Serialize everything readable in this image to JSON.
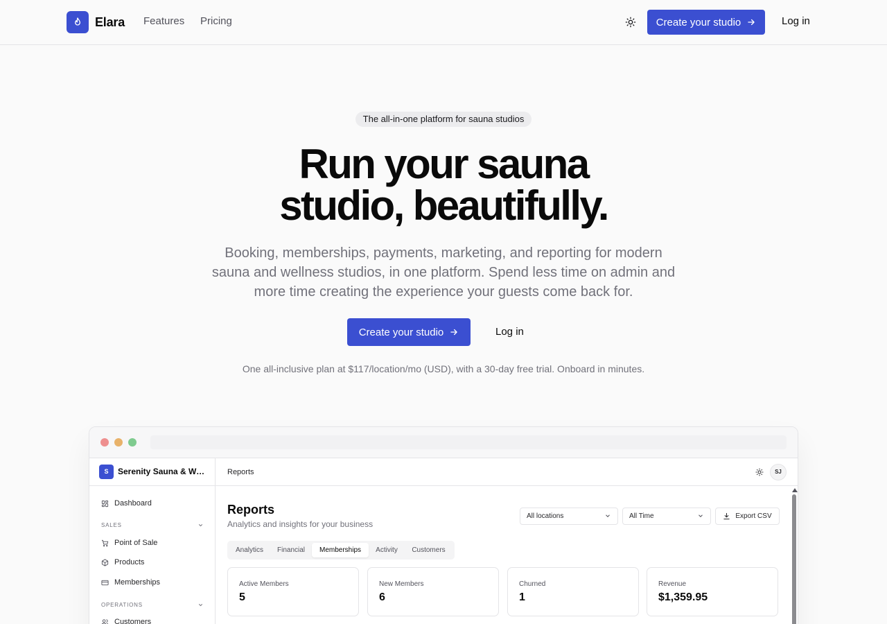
{
  "colors": {
    "accent": "#3b4fd1",
    "background": "#fafafa",
    "muted_text": "#71717a"
  },
  "nav": {
    "brand": "Elara",
    "brand_icon": "flame-icon",
    "links": [
      "Features",
      "Pricing"
    ],
    "theme_icon": "sun-icon",
    "cta_label": "Create your studio",
    "login_label": "Log in"
  },
  "hero": {
    "badge": "The all-in-one platform for sauna studios",
    "title_line1": "Run your sauna",
    "title_line2": "studio, beautifully.",
    "subtitle": "Booking, memberships, payments, marketing, and reporting for modern sauna and wellness studios, in one platform. Spend less time on admin and more time creating the experience your guests come back for.",
    "cta_label": "Create your studio",
    "login_label": "Log in",
    "note": "One all-inclusive plan at $117/location/mo (USD), with a 30-day free trial. Onboard in minutes."
  },
  "app": {
    "studio_initial": "S",
    "studio_name": "Serenity Sauna & Wellness",
    "sidebar": {
      "dashboard": "Dashboard",
      "sales_heading": "SALES",
      "sales_items": [
        "Point of Sale",
        "Products",
        "Memberships"
      ],
      "operations_heading": "OPERATIONS",
      "operations_items": [
        "Customers"
      ]
    },
    "breadcrumb": "Reports",
    "avatar_initials": "SJ",
    "page_title": "Reports",
    "page_subtitle": "Analytics and insights for your business",
    "location_filter": "All locations",
    "time_filter": "All Time",
    "export_label": "Export CSV",
    "tabs": [
      "Analytics",
      "Financial",
      "Memberships",
      "Activity",
      "Customers"
    ],
    "active_tab": "Memberships",
    "stats": [
      {
        "label": "Active Members",
        "value": "5"
      },
      {
        "label": "New Members",
        "value": "6"
      },
      {
        "label": "Churned",
        "value": "1"
      },
      {
        "label": "Revenue",
        "value": "$1,359.95"
      }
    ]
  }
}
